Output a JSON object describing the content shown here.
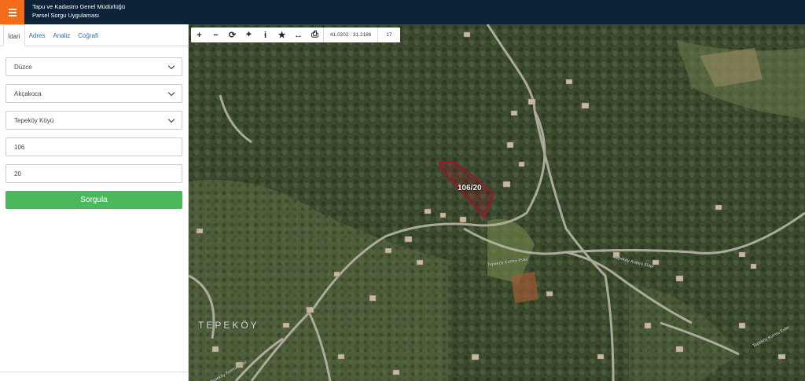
{
  "header": {
    "title_line1": "Tapu ve Kadastro Genel Müdürlüğü",
    "title_line2": "Parsel Sorgu Uygulaması"
  },
  "sidebar": {
    "tabs": [
      {
        "label": "İdari",
        "active": true
      },
      {
        "label": "Adres",
        "active": false
      },
      {
        "label": "Analiz",
        "active": false
      },
      {
        "label": "Coğrafi",
        "active": false
      }
    ],
    "form": {
      "province": "Düzce",
      "district": "Akçakoca",
      "neighborhood": "Tepeköy Köyü",
      "block": "106",
      "parcel": "20",
      "submit_label": "Sorgula"
    }
  },
  "map": {
    "toolbar": {
      "coordinates": "41.0202 : 31.2186",
      "zoom": "17"
    },
    "parcel_label": "106/20",
    "village_label": "TEPEKÖY",
    "road_labels": [
      "Tepeköy Kumru Evler",
      "Tepeköy Kumru Evler",
      "Tepeköy Kumru Evler",
      "Tepeköy Kumru Evler"
    ],
    "colors": {
      "parcel_outline": "#a0132a",
      "submit_button": "#4bb95b",
      "menu_button": "#f26c1a",
      "header": "#0d2338"
    }
  }
}
